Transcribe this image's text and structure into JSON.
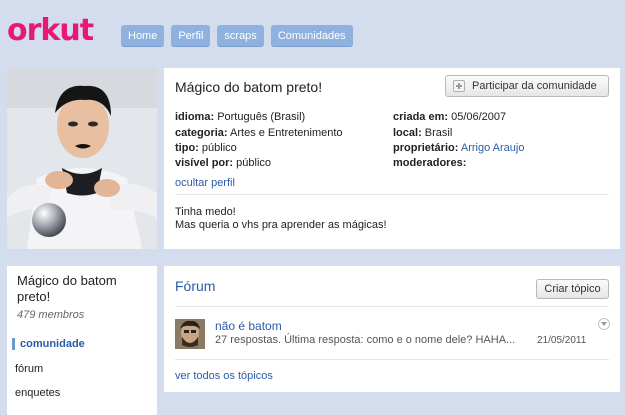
{
  "header": {
    "logo": "orkut",
    "nav": [
      "Home",
      "Perfil",
      "scraps",
      "Comunidades"
    ]
  },
  "community": {
    "title": "Mágico do batom preto!",
    "join_label": "Participar da comunidade",
    "fields": {
      "idioma_label": "idioma:",
      "idioma": "Português (Brasil)",
      "categoria_label": "categoria:",
      "categoria": "Artes e Entretenimento",
      "tipo_label": "tipo:",
      "tipo": "público",
      "visivel_label": "visível por:",
      "visivel": "público",
      "criada_label": "criada em:",
      "criada": "05/06/2007",
      "local_label": "local:",
      "local": "Brasil",
      "proprietario_label": "proprietário:",
      "proprietario": "Arrigo Araujo",
      "moderadores_label": "moderadores:"
    },
    "hide_profile": "ocultar perfil",
    "description": [
      "Tinha medo!",
      "Mas queria o vhs pra aprender as mágicas!"
    ]
  },
  "sidebar": {
    "title": "Mágico do batom preto!",
    "members": "479 membros",
    "items": [
      "comunidade",
      "fórum",
      "enquetes"
    ]
  },
  "forum": {
    "title": "Fórum",
    "create_label": "Criar tópico",
    "topic": {
      "title": "não é batom",
      "meta": "27 respostas.  Última resposta: como e o nome dele? HAHA...",
      "date": "21/05/2011"
    },
    "all_topics": "ver todos os tópicos"
  },
  "colors": {
    "brand": "#e8177a",
    "nav": "#8fb1df",
    "background": "#d4dded",
    "link": "#2a5ca8"
  }
}
